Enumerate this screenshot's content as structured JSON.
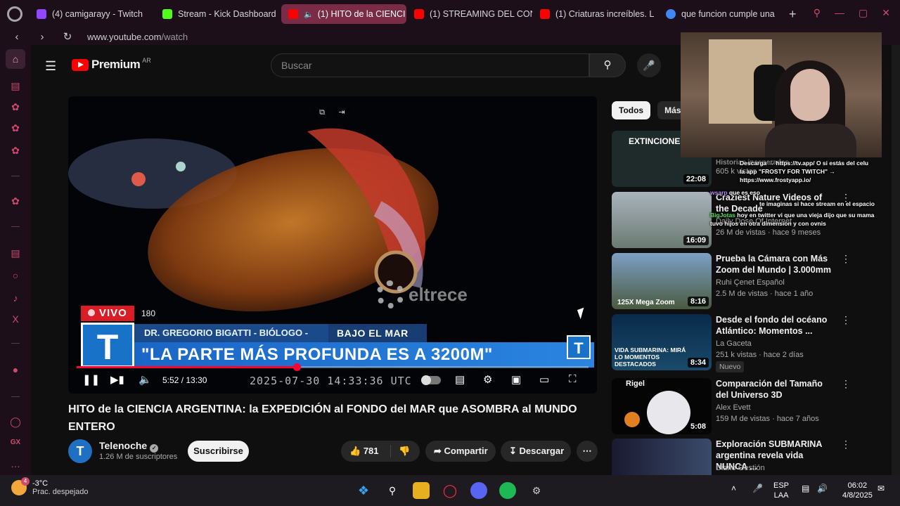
{
  "browser": {
    "tabs": [
      {
        "label": "(4) camigarayy - Twitch",
        "color": "#9146ff"
      },
      {
        "label": "Stream - Kick Dashboard",
        "color": "#53fc18"
      },
      {
        "label": "(1) HITO de la CIENCI",
        "color": "#ff0000",
        "active": true
      },
      {
        "label": "(1) STREAMING DEL CON",
        "color": "#ff0000"
      },
      {
        "label": "(1) Criaturas increíbles. L",
        "color": "#ff0000"
      },
      {
        "label": "que funcion cumple una",
        "color": "#4285f4"
      }
    ],
    "url_host": "www.youtube.com",
    "url_path": "/watch"
  },
  "youtube": {
    "logo_text": "Premium",
    "region": "AR",
    "search_placeholder": "Buscar",
    "player": {
      "vivo_label": "VIVO",
      "vivo_num": "180",
      "lower_name": "DR. GREGORIO BIGATTI - BIÓLOGO - CONICET",
      "lower_tag": "BAJO EL MAR",
      "lower_quote": "\"LA PARTE MÁS PROFUNDA ES A 3200M\"",
      "t_letter": "T",
      "watermark": "eltrece",
      "time": "5:52 / 13:30",
      "timestamp": "2025-07-30 14:33:36 UTC",
      "progress": 0.43
    },
    "title": "HITO de la CIENCIA ARGENTINA: la EXPEDICIÓN al FONDO del MAR que ASOMBRA al MUNDO ENTERO",
    "channel": {
      "name": "Telenoche",
      "subs": "1.26 M de suscriptores",
      "avatar_letter": "T"
    },
    "subscribe_label": "Suscribirse",
    "likes": "781",
    "share_label": "Compartir",
    "download_label": "Descargar",
    "chips": [
      "Todos",
      "Más d"
    ],
    "recommendations": [
      {
        "title": "Historias inesperadas",
        "channel": "",
        "meta": "605 k vistas",
        "duration": "22:08",
        "thumb_text": "EXTINCIONES MAS"
      },
      {
        "title": "Craziest Nature Videos of the Decade",
        "channel": "Daily Dose Of Internet",
        "meta": "26 M de vistas · hace 9 meses",
        "duration": "16:09",
        "thumb_text": ""
      },
      {
        "title": "Prueba la Cámara con Más Zoom del Mundo | 3.000mm",
        "channel": "Ruhi Çenet Español",
        "meta": "2.5 M de vistas · hace 1 año",
        "duration": "8:16",
        "thumb_text": "125X Mega Zoom"
      },
      {
        "title": "Desde el fondo del océano Atlántico: Momentos ...",
        "channel": "La Gaceta",
        "meta": "251 k vistas · hace 2 días",
        "duration": "8:34",
        "badge": "Nuevo",
        "thumb_text": "VIDA SUBMARINA: MIRÁ LO MOMENTOS DESTACADOS"
      },
      {
        "title": "Comparación del Tamaño del Universo 3D",
        "channel": "Alex Evett",
        "meta": "159 M de vistas · hace 7 años",
        "duration": "5:08",
        "thumb_text": "Rigel"
      },
      {
        "title": "Exploración SUBMARINA argentina revela vida NUNCA ...",
        "channel": "Diario Gestión",
        "meta": "",
        "duration": "",
        "thumb_text": ""
      }
    ]
  },
  "stream_overlay": {
    "chat": [
      {
        "user": "",
        "text": "Descarga → https://tv.app/ O si estás del celu la app \"FROSTY FOR TWITCH\" → https://www.frostyapp.io/"
      },
      {
        "user": "wsarp",
        "text": "que es eso"
      },
      {
        "user": "",
        "text": "te imaginas si hace stream en el espacio"
      },
      {
        "user": "BigJotas",
        "text": "hoy en twitter vi que una vieja dijo que su mama tuvo hijos en otra dimension y con ovnis"
      }
    ]
  },
  "taskbar": {
    "weather_temp": "-3°C",
    "weather_desc": "Prac. despejado",
    "weather_badge": "4",
    "lang_top": "ESP",
    "lang_bottom": "LAA",
    "time": "06:02",
    "date": "4/8/2025"
  }
}
